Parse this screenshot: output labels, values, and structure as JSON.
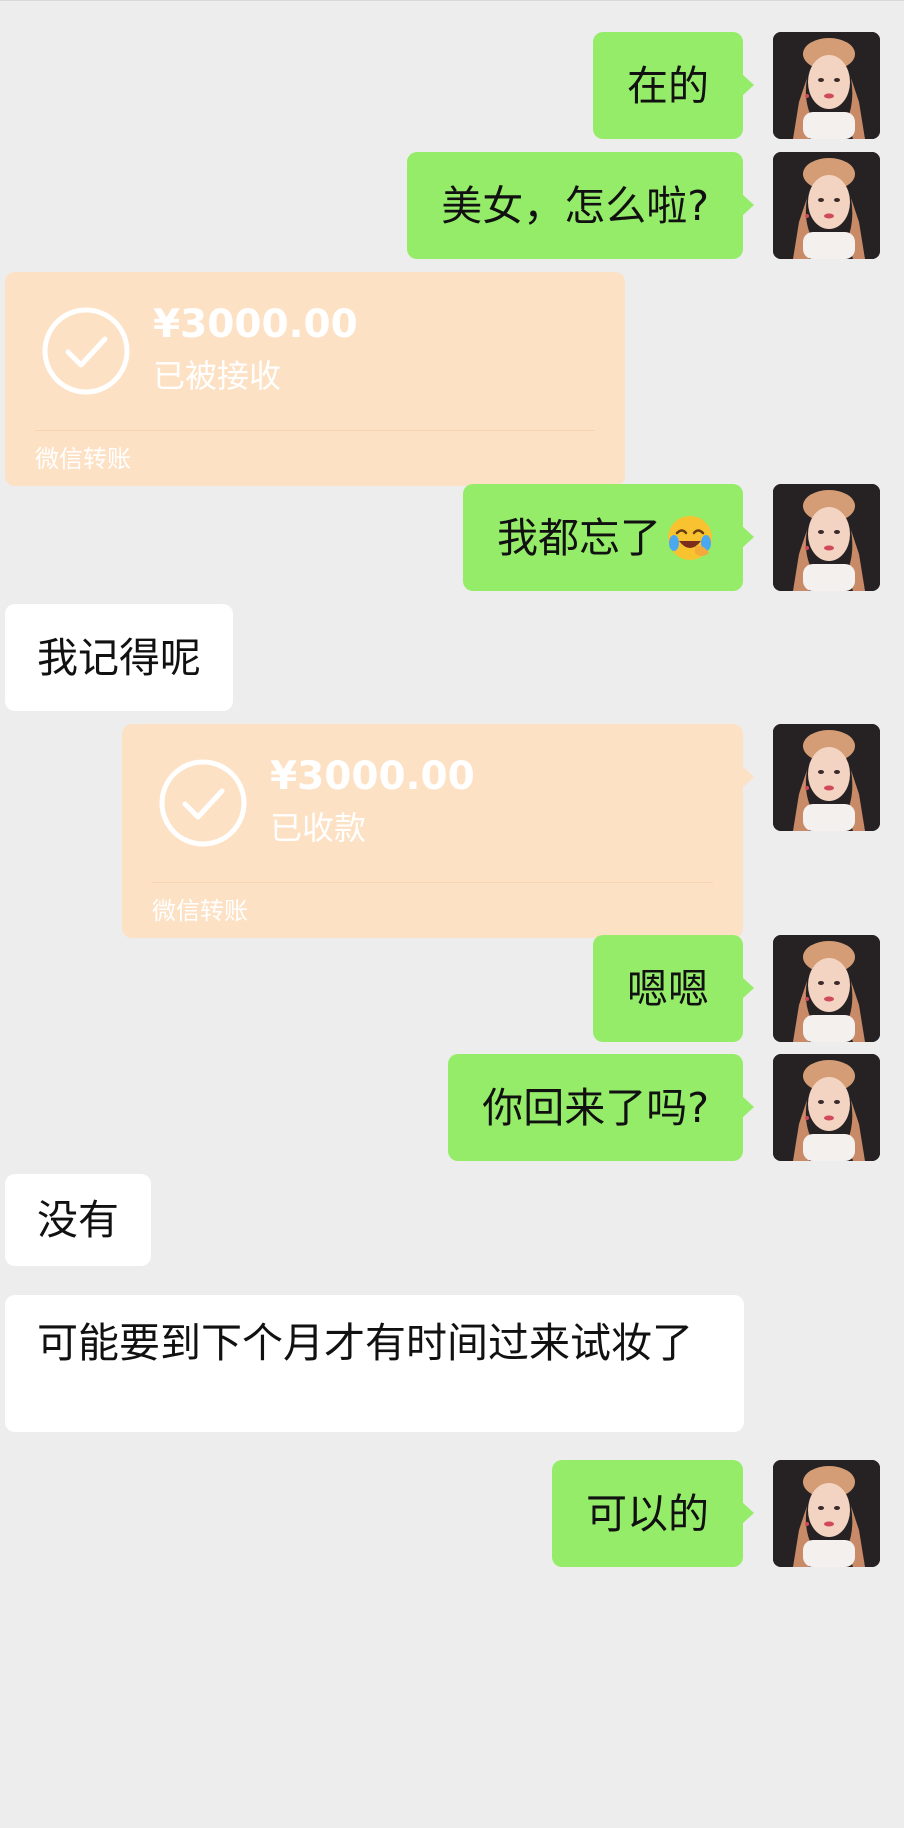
{
  "messages": {
    "m1": {
      "text": "在的"
    },
    "m2": {
      "text": "美女，怎么啦?"
    },
    "t1": {
      "amount": "¥3000.00",
      "status": "已被接收",
      "footer": "微信转账"
    },
    "m3": {
      "text": "我都忘了",
      "emoji": "face-with-tears-of-joy-icon"
    },
    "m4": {
      "text": "我记得呢"
    },
    "t2": {
      "amount": "¥3000.00",
      "status": "已收款",
      "footer": "微信转账"
    },
    "m5": {
      "text": "嗯嗯"
    },
    "m6": {
      "text": "你回来了吗?"
    },
    "m7": {
      "text": "没有"
    },
    "m8": {
      "text": "可能要到下个月才有时间过来试妆了"
    },
    "m9": {
      "text": "可以的"
    }
  },
  "colors": {
    "background": "#ededed",
    "sent_bubble": "#95ec69",
    "received_bubble": "#ffffff",
    "transfer_card": "#fde1c4"
  }
}
